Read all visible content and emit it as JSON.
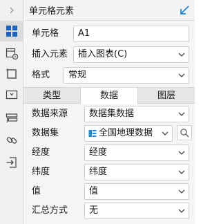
{
  "header": {
    "title": "单元格元素"
  },
  "rail": {
    "items": [
      {
        "icon": "collapse-arrow-icon"
      },
      {
        "icon": "cell-element-icon",
        "active": true
      },
      {
        "icon": "cell-attribute-icon"
      },
      {
        "icon": "border-icon"
      },
      {
        "icon": "widget-icon"
      },
      {
        "icon": "condition-icon"
      },
      {
        "icon": "hyperlink-icon"
      },
      {
        "icon": "import-icon"
      }
    ]
  },
  "form": {
    "cell_label": "单元格",
    "cell_value": "A1",
    "insert_label": "插入元素",
    "insert_value": "插入图表(C)",
    "format_label": "格式",
    "format_value": "常规"
  },
  "tabs": [
    {
      "label": "类型",
      "active": false
    },
    {
      "label": "数据",
      "active": true
    },
    {
      "label": "图层",
      "active": false
    }
  ],
  "data_form": {
    "source_label": "数据来源",
    "source_value": "数据集数据",
    "dataset_label": "数据集",
    "dataset_value": "全国地理数据",
    "longitude_label": "经度",
    "longitude_value": "经度",
    "latitude_label": "纬度",
    "latitude_value": "纬度",
    "value_label": "值",
    "value_value": "值",
    "agg_label": "汇总方式",
    "agg_value": "无"
  },
  "colors": {
    "accent": "#1e88e5",
    "active_rail_icon": "#1565c0"
  }
}
